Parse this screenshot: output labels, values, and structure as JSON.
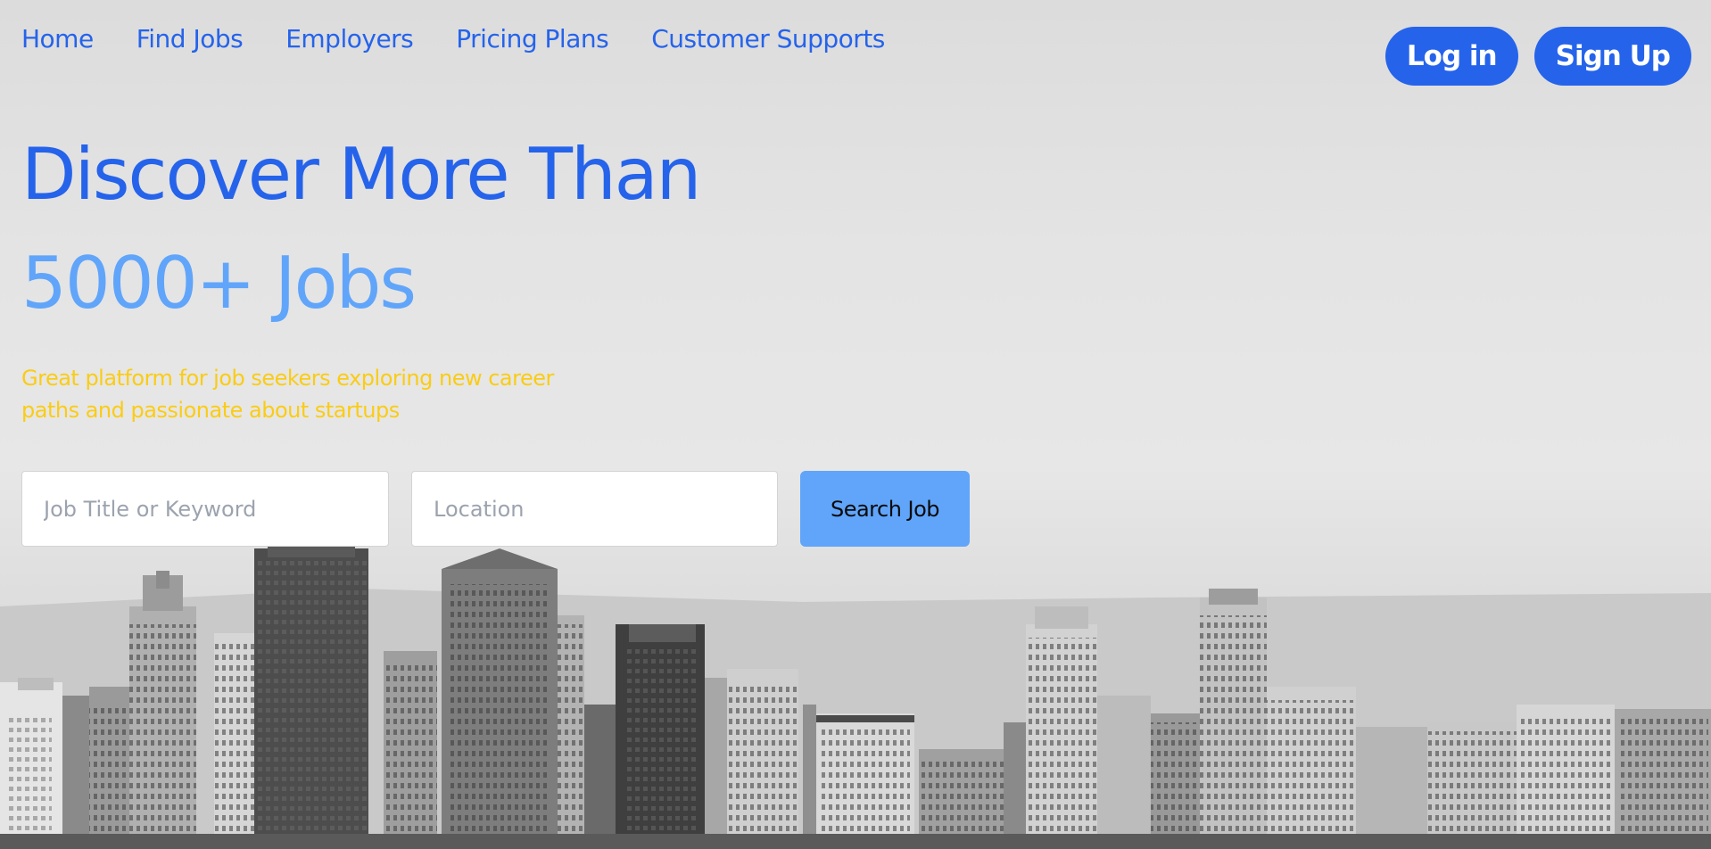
{
  "nav": {
    "items": [
      {
        "label": "Home"
      },
      {
        "label": "Find Jobs"
      },
      {
        "label": "Employers"
      },
      {
        "label": "Pricing Plans"
      },
      {
        "label": "Customer Supports"
      }
    ]
  },
  "auth": {
    "login_label": "Log in",
    "signup_label": "Sign Up"
  },
  "hero": {
    "title_line1": "Discover More Than",
    "title_line2": "5000+ Jobs",
    "subtitle": "Great platform for job seekers exploring new career paths and passionate about startups"
  },
  "search": {
    "keyword_placeholder": "Job Title or Keyword",
    "location_placeholder": "Location",
    "button_label": "Search Job"
  },
  "colors": {
    "primary": "#2563eb",
    "secondary": "#60a5fa",
    "accent": "#facc15"
  }
}
